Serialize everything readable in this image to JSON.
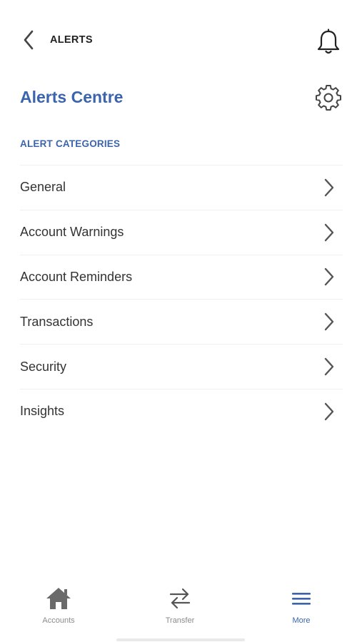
{
  "header": {
    "title": "ALERTS",
    "back_icon": "chevron-left-icon",
    "bell_icon": "bell-icon"
  },
  "page": {
    "title": "Alerts Centre",
    "settings_icon": "gear-icon"
  },
  "section": {
    "title": "ALERT CATEGORIES"
  },
  "categories": [
    {
      "label": "General"
    },
    {
      "label": "Account Warnings"
    },
    {
      "label": "Account Reminders"
    },
    {
      "label": "Transactions"
    },
    {
      "label": "Security"
    },
    {
      "label": "Insights"
    }
  ],
  "tabbar": {
    "tabs": [
      {
        "label": "Accounts",
        "icon": "home-icon",
        "active": false
      },
      {
        "label": "Transfer",
        "icon": "transfer-icon",
        "active": false
      },
      {
        "label": "More",
        "icon": "menu-icon",
        "active": true
      }
    ]
  },
  "colors": {
    "accent": "#3b64ad",
    "text": "#333333",
    "muted": "#8a8a8a",
    "divider": "#efefef"
  }
}
